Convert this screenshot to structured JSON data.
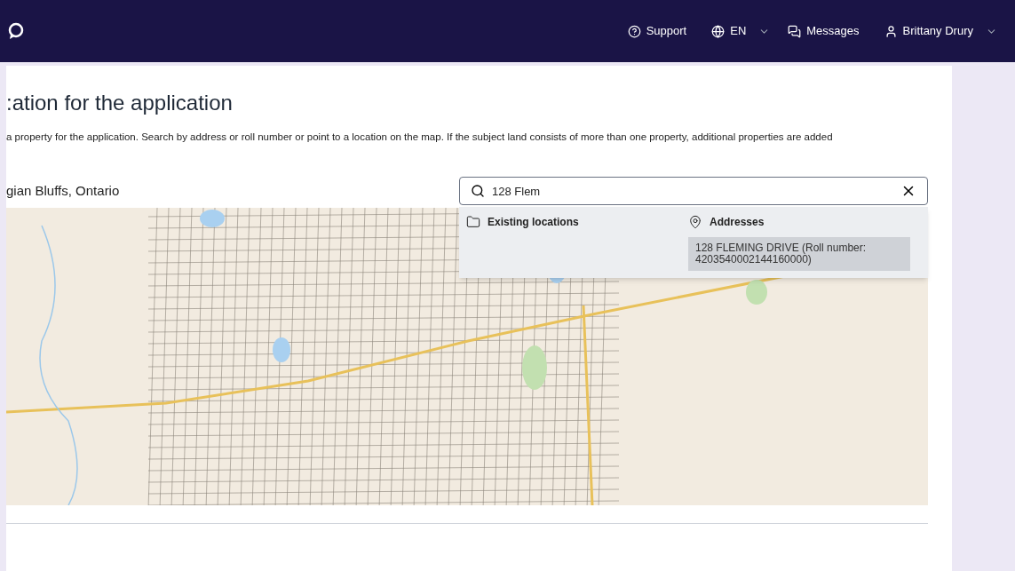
{
  "header": {
    "support": "Support",
    "language": "EN",
    "messages": "Messages",
    "user": "Brittany Drury"
  },
  "page": {
    "title": ":ation for the application",
    "description": "a property for the application. Search by address or roll number or point to a location on the map. If the subject land consists of more than one property, additional properties are added",
    "municipality": "gian Bluffs, Ontario"
  },
  "search": {
    "value": "128 Flem"
  },
  "dropdown": {
    "groups": [
      {
        "kind": "folder",
        "label": "Existing locations"
      },
      {
        "kind": "pin",
        "label": "Addresses",
        "items": [
          {
            "text": "128 FLEMING DRIVE (Roll number: 4203540002144160000)",
            "selected": true
          }
        ]
      }
    ]
  }
}
